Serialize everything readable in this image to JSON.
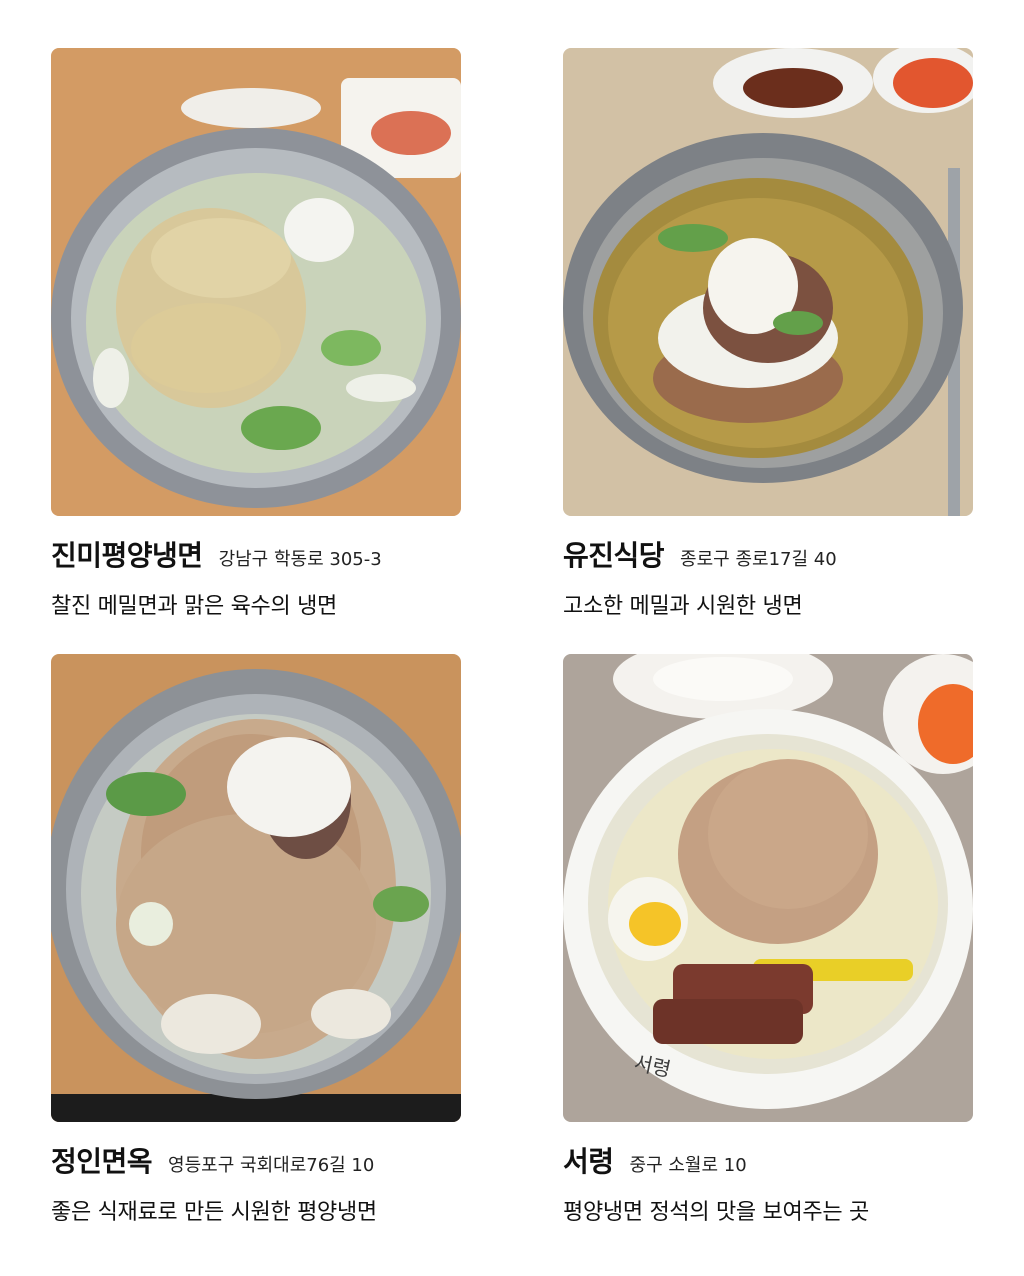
{
  "restaurants": [
    {
      "name": "진미평양냉면",
      "address": "강남구 학동로 305-3",
      "description": "찰진 메밀면과 맑은 육수의 냉면",
      "photo": "naengmyeon-photo"
    },
    {
      "name": "유진식당",
      "address": "종로구 종로17길 40",
      "description": "고소한 메밀과 시원한 냉면",
      "photo": "naengmyeon-photo"
    },
    {
      "name": "정인면옥",
      "address": "영등포구 국회대로76길 10",
      "description": "좋은 식재료로 만든 시원한 평양냉면",
      "photo": "naengmyeon-photo"
    },
    {
      "name": "서령",
      "address": "중구 소월로 10",
      "description": "평양냉면 정석의 맛을 보여주는 곳",
      "photo": "naengmyeon-photo",
      "bowl_mark": "서령"
    }
  ]
}
